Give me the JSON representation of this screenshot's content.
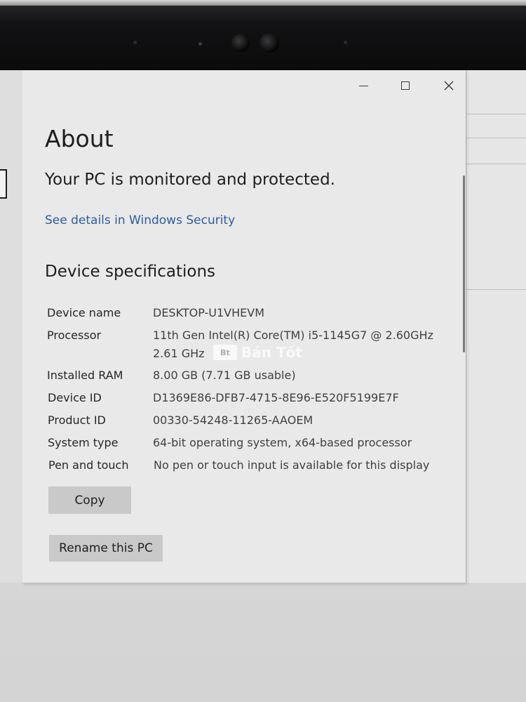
{
  "window": {
    "controls": {
      "minimize_icon": "minimize-icon",
      "maximize_icon": "maximize-icon",
      "close_icon": "close-icon"
    }
  },
  "about": {
    "title": "About",
    "status": "Your PC is monitored and protected.",
    "security_link": "See details in Windows Security"
  },
  "device_specs": {
    "title": "Device specifications",
    "rows": [
      {
        "label": "Device name",
        "value": "DESKTOP-U1VHEVM"
      },
      {
        "label": "Processor",
        "value": "11th Gen Intel(R) Core(TM) i5-1145G7 @ 2.60GHz",
        "value_line2": "2.61 GHz"
      },
      {
        "label": "Installed RAM",
        "value": "8.00 GB (7.71 GB usable)"
      },
      {
        "label": "Device ID",
        "value": "D1369E86-DFB7-4715-8E96-E520F5199E7F"
      },
      {
        "label": "Product ID",
        "value": "00330-54248-11265-AAOEM"
      },
      {
        "label": "System type",
        "value": "64-bit operating system, x64-based processor"
      },
      {
        "label": "Pen and touch",
        "value": "No pen or touch input is available for this display"
      }
    ]
  },
  "buttons": {
    "copy": "Copy",
    "rename": "Rename this PC"
  },
  "watermark": {
    "badge": "Bt",
    "text": "Bán Tốt"
  },
  "colors": {
    "link": "#2e5d98",
    "button_bg": "#c9c9c9",
    "window_bg": "#e9e9e9"
  }
}
